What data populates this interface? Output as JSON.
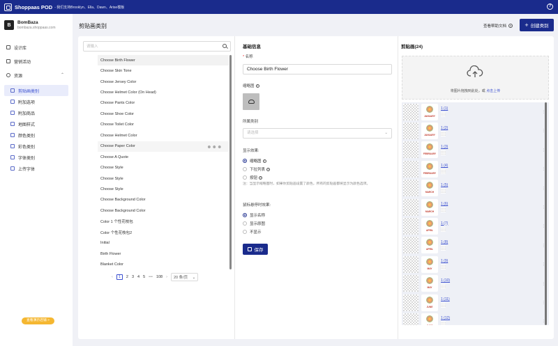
{
  "topbar": {
    "brand": "Shoppaas POD",
    "tagline": "- 我们支持Brooklyn、Ella、Dawn、Arise模板",
    "help_icon": "question-circle-icon"
  },
  "store": {
    "avatar": "B",
    "name": "BomBaza",
    "domain": "bombaza.shoppaas.com"
  },
  "sidebar": {
    "items": [
      {
        "label": "设计库",
        "icon": "layers-icon"
      },
      {
        "label": "营销活动",
        "icon": "megaphone-icon"
      },
      {
        "label": "资源",
        "icon": "star-icon",
        "expanded": true
      }
    ],
    "sub_items": [
      {
        "label": "剪贴画类别",
        "icon": "image-icon",
        "active": true
      },
      {
        "label": "附加选项",
        "icon": "options-icon"
      },
      {
        "label": "附加商品",
        "icon": "product-icon"
      },
      {
        "label": "地图样式",
        "icon": "map-icon"
      },
      {
        "label": "颜色类别",
        "icon": "palette-icon"
      },
      {
        "label": "彩色类别",
        "icon": "color-icon"
      },
      {
        "label": "字体类别",
        "icon": "font-icon"
      },
      {
        "label": "上传字体",
        "icon": "upload-font-icon"
      }
    ],
    "demo_button": "查看演示店铺 >"
  },
  "header": {
    "title": "剪贴画类别",
    "doc_link": "查看帮助文档",
    "create_button": "创建类别"
  },
  "left_panel": {
    "search_placeholder": "请输入",
    "items": [
      "Choose Birth Flower",
      "Choose Skin Tone",
      "Choose Jersey Color",
      "Choose Helmet Color (On Head)",
      "Choose Pants Color",
      "Choose Shoe Color",
      "Choose Toilet Color",
      "Choose Helmet Color",
      "Choose Paper Color",
      "Choose A Quote",
      "Choose Style",
      "Choose Style",
      "Choose Style",
      "Choose Background Color",
      "Choose Background Color",
      "Color 1 个性花枝包",
      "Color 个性花枝包2",
      "Initial",
      "Birth Flower",
      "Blanket Color"
    ],
    "pagination": {
      "pages": [
        "1",
        "2",
        "3",
        "4",
        "5"
      ],
      "current": "1",
      "ellipsis": "•••",
      "last": "108",
      "page_size": "20 条/页"
    }
  },
  "form": {
    "section_title": "基础信息",
    "name_label": "名称",
    "name_value": "Choose Birth Flower",
    "thumb_label": "缩略图",
    "category_label": "所属类别",
    "category_placeholder": "请选择",
    "display_label": "显示效果:",
    "display_options": [
      "缩略图",
      "下拉列表",
      "按钮"
    ],
    "display_note": "注：当显示缩略图时，如果你剪贴画设置了颜色，所有的剪贴画都将显示为颜色选项。",
    "hover_label": "鼠标悬停时效果:",
    "hover_options": [
      "显示名称",
      "显示原图",
      "不显示"
    ],
    "save_button": "保存"
  },
  "clipart": {
    "title": "剪贴画(24)",
    "drop_text": "将图片拖拽到此处，或",
    "upload_link": "点击上传",
    "items": [
      {
        "num": "1 (1)",
        "month": "JANUARY"
      },
      {
        "num": "1 (2)",
        "month": "JANUARY"
      },
      {
        "num": "1 (3)",
        "month": "FEBRUARY"
      },
      {
        "num": "1 (4)",
        "month": "FEBRUARY"
      },
      {
        "num": "1 (5)",
        "month": "MARCH"
      },
      {
        "num": "1 (6)",
        "month": "MARCH"
      },
      {
        "num": "1 (7)",
        "month": "APRIL"
      },
      {
        "num": "1 (8)",
        "month": "APRIL"
      },
      {
        "num": "1 (9)",
        "month": "MAY"
      },
      {
        "num": "1 (10)",
        "month": "MAY"
      },
      {
        "num": "1 (11)",
        "month": "JUNE"
      },
      {
        "num": "1 (12)",
        "month": "JUNE"
      }
    ]
  }
}
